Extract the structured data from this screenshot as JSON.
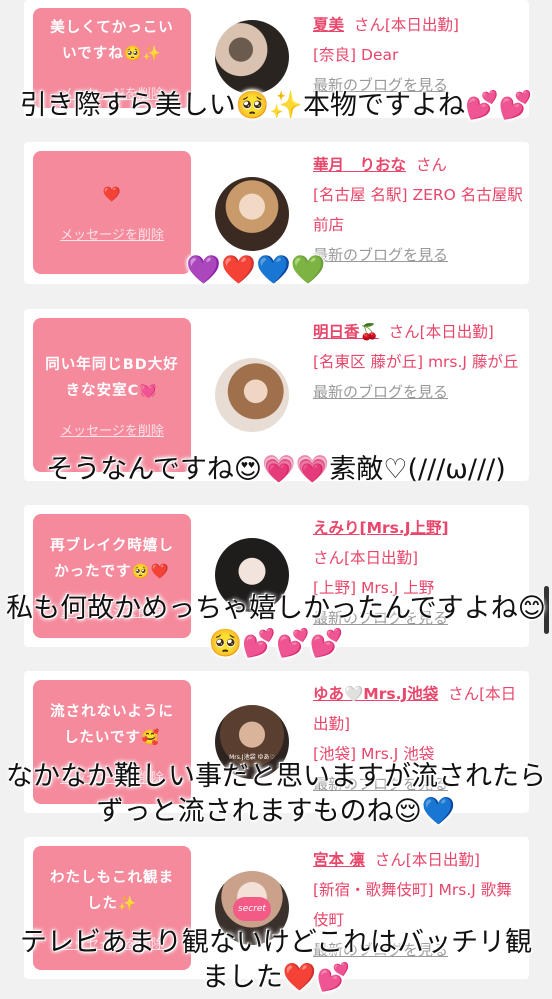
{
  "cards": [
    {
      "message": "美しくてかっこいいですね🥺✨",
      "delete_label": "メッセージを削除",
      "name": "夏美",
      "suffix": "さん[本日出勤]",
      "area": "[奈良] Dear",
      "blog_label": "最新のブログを見る"
    },
    {
      "message": "❤️",
      "delete_label": "メッセージを削除",
      "name": "華月　りおな",
      "suffix": "さん",
      "area": "[名古屋 名駅] ZERO 名古屋駅前店",
      "blog_label": "最新のブログを見る"
    },
    {
      "message": "同い年同じBD大好きな安室C💓",
      "delete_label": "メッセージを削除",
      "name": "明日香🍒",
      "suffix": "さん[本日出勤]",
      "area": "[名東区 藤が丘] mrs.J 藤が丘",
      "blog_label": "最新のブログを見る"
    },
    {
      "message": "再ブレイク時嬉しかったです🥺❤️",
      "delete_label": "メッセージを削除",
      "name": "えみり[Mrs.J上野]",
      "suffix": "さん[本日出勤]",
      "area": "[上野] Mrs.J 上野",
      "blog_label": "最新のブログを見る"
    },
    {
      "message": "流されないようにしたいです🥰",
      "delete_label": "メッセージを削除",
      "name": "ゆあ🤍Mrs.J池袋",
      "suffix": "さん[本日出勤]",
      "area": "[池袋] Mrs.J 池袋",
      "blog_label": "最新のブログを見る"
    },
    {
      "message": "わたしもこれ観ました✨",
      "delete_label": "メッセージを削除",
      "name": "宮本 凛",
      "suffix": "さん[本日出勤]",
      "area": "[新宿・歌舞伎町] Mrs.J 歌舞伎町",
      "blog_label": "最新のブログを見る"
    }
  ],
  "avatar_texts": {
    "card5": "Mrs.J池袋 ゆあ♡",
    "card6": "secret"
  },
  "captions": [
    "引き際すら美しい🥺✨本物ですよね💕💕",
    "💜❤️💙💚",
    "そうなんですね😍💗💗素敵♡(///ω///)",
    "私も何故かめっちゃ嬉しかったんですよね😊🥺💕💕💕",
    "なかなか難しい事だと思いますが流されたらずっと流されますものね😌💙",
    "テレビあまり観ないけどこれはバッチリ観ました❤️💕"
  ],
  "colors": {
    "accent": "#e8466a",
    "bubble": "#f48a9c",
    "background": "#f1f1f1"
  }
}
